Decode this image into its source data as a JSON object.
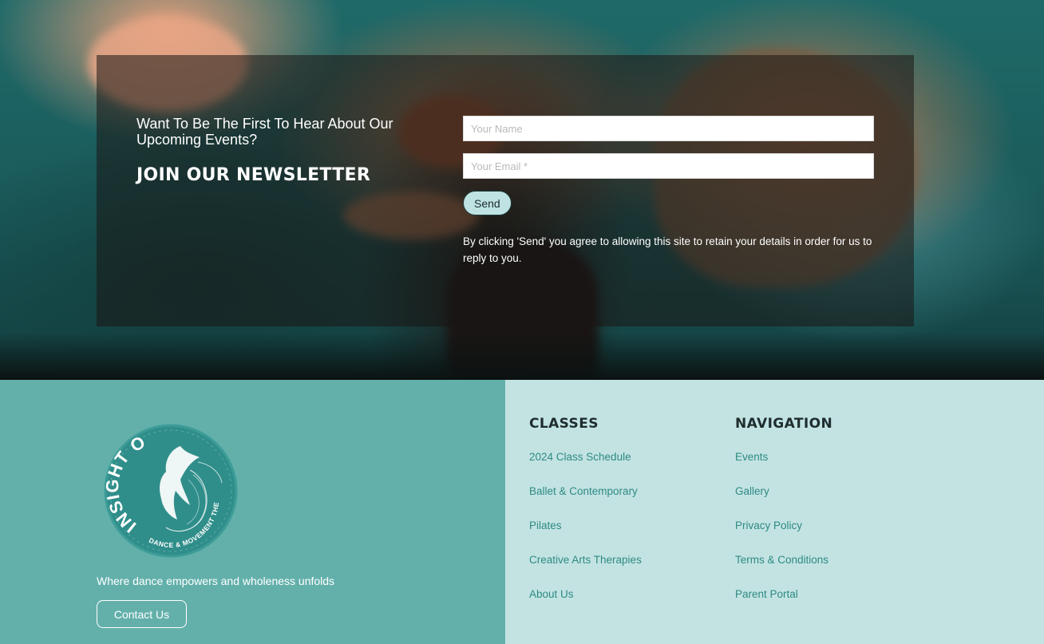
{
  "newsletter": {
    "heading": "Want To Be The First To Hear About Our Upcoming Events?",
    "title": "JOIN OUR NEWSLETTER",
    "name_placeholder": "Your Name",
    "email_placeholder": "Your Email *",
    "send_label": "Send",
    "consent_note": "By clicking 'Send' you agree to allowing this site to retain your details in order for us to reply to you."
  },
  "footer": {
    "logo": {
      "name_text": "INSIGHT OUT",
      "sub_text": "DANCE & MOVEMENT THERAPY"
    },
    "tagline": "Where dance empowers and wholeness unfolds",
    "contact_label": "Contact Us",
    "classes": {
      "title": "CLASSES",
      "links": [
        "2024 Class Schedule",
        "Ballet & Contemporary",
        "Pilates",
        "Creative Arts Therapies",
        "About Us"
      ]
    },
    "navigation": {
      "title": "NAVIGATION",
      "links": [
        "Events",
        "Gallery",
        "Privacy Policy",
        "Terms & Conditions",
        "Parent Portal"
      ]
    }
  },
  "colors": {
    "footer_left_bg": "#63b0ab",
    "footer_right_bg": "#c3e3e3",
    "link": "#2e8a83",
    "send_button_bg": "#bfe3e3"
  }
}
